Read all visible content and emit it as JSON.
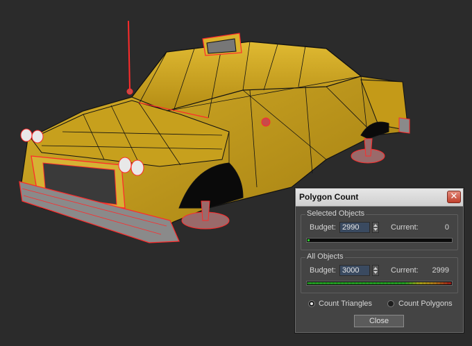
{
  "viewport": {
    "background": "#2b2b2b",
    "model_color": "#c9a21f",
    "selection_color": "#ff2b2b"
  },
  "dialog": {
    "title": "Polygon Count",
    "close_icon": "close-x-icon",
    "selected_objects": {
      "label": "Selected Objects",
      "budget_label": "Budget:",
      "budget_value": "2990",
      "current_label": "Current:",
      "current_value": "0",
      "meter_fraction": 0.0
    },
    "all_objects": {
      "label": "All Objects",
      "budget_label": "Budget:",
      "budget_value": "3000",
      "current_label": "Current:",
      "current_value": "2999",
      "meter_fraction": 0.9997
    },
    "count_triangles_label": "Count Triangles",
    "count_polygons_label": "Count Polygons",
    "selected_mode": "triangles",
    "close_label": "Close"
  }
}
